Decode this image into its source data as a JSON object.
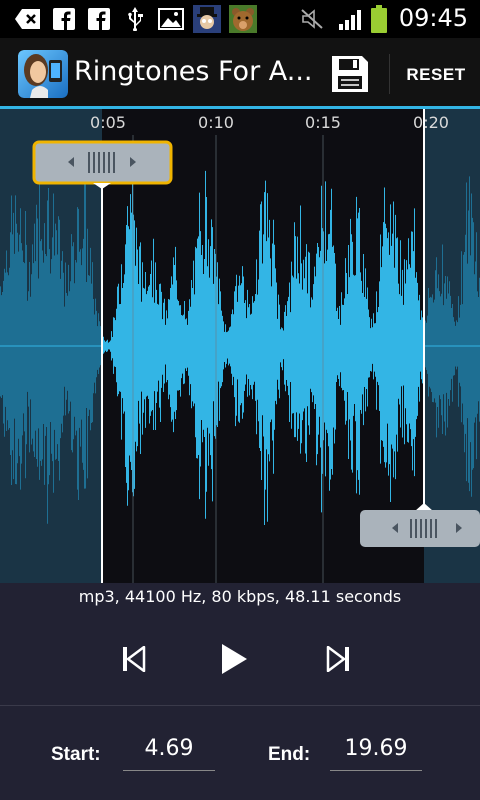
{
  "status_bar": {
    "time": "09:45",
    "icons": [
      "back-icon",
      "facebook-icon",
      "facebook-icon",
      "usb-icon",
      "gallery-icon",
      "game-icon",
      "bear-icon",
      "mute-icon",
      "signal-icon",
      "battery-icon"
    ]
  },
  "action_bar": {
    "title": "Ringtones For A...",
    "save_icon": "save-icon",
    "reset_label": "RESET",
    "accent": "#33b5e5"
  },
  "waveform": {
    "time_markers": [
      "0:05",
      "0:10",
      "0:15",
      "0:20"
    ],
    "wave_color": "#33b5e5",
    "start_handle": "start-marker-handle",
    "end_handle": "end-marker-handle"
  },
  "file_info": "mp3, 44100 Hz, 80 kbps, 48.11 seconds",
  "controls": {
    "previous_icon": "skip-previous-icon",
    "play_icon": "play-icon",
    "next_icon": "skip-next-icon"
  },
  "bottom": {
    "start_label": "Start:",
    "start_value": "4.69",
    "end_label": "End:",
    "end_value": "19.69"
  }
}
